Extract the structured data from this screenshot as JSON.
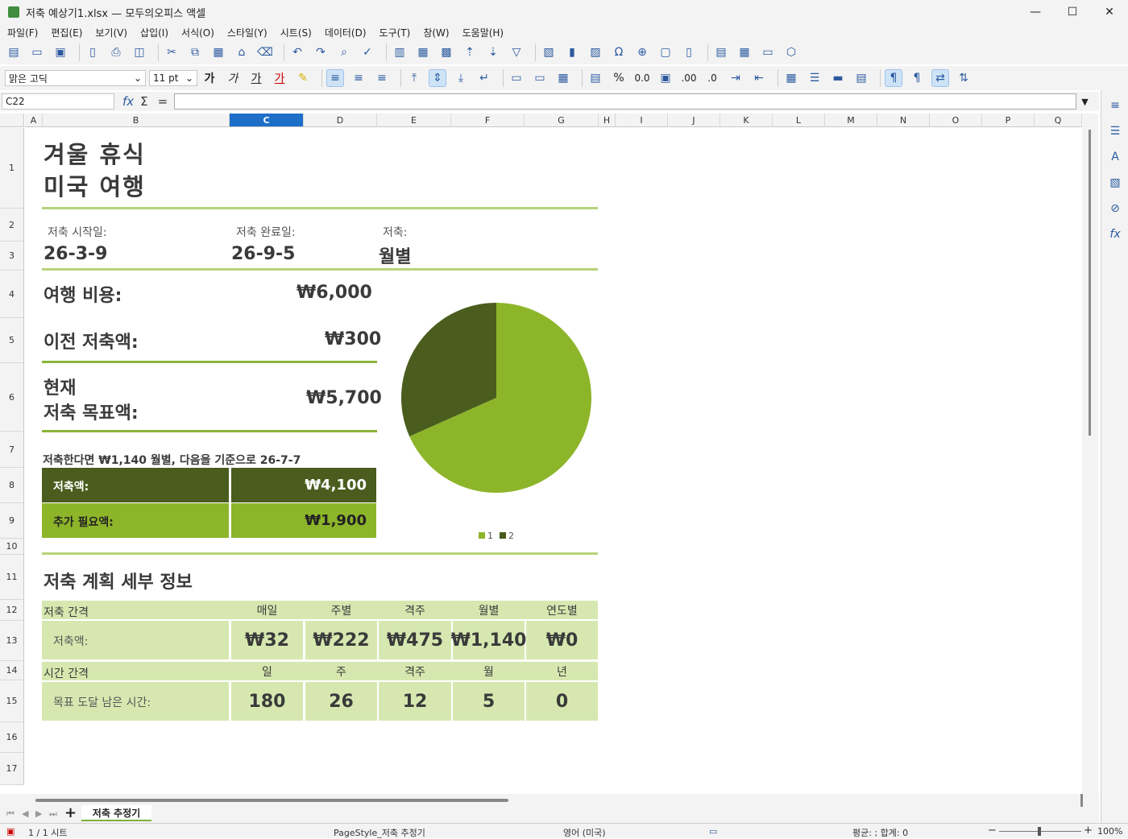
{
  "window": {
    "title": "저축 예상기1.xlsx — 모두의오피스 액셀",
    "minimize": "—",
    "maximize": "☐",
    "close": "✕"
  },
  "menu": [
    "파일(F)",
    "편집(E)",
    "보기(V)",
    "삽입(I)",
    "서식(O)",
    "스타일(Y)",
    "시트(S)",
    "데이터(D)",
    "도구(T)",
    "창(W)",
    "도움말(H)"
  ],
  "format_bar": {
    "font_name": "맑은 고딕",
    "font_size": "11 pt",
    "bold": "가",
    "italic": "가",
    "underline": "가",
    "font_color": "가",
    "percent": "%",
    "number": "0.0",
    "decimal_add": ".00",
    "decimal_remove": ".0"
  },
  "formula_bar": {
    "cell_ref": "C22",
    "fx": "fx",
    "sum": "Σ",
    "equals": "=",
    "value": ""
  },
  "columns": [
    "A",
    "B",
    "C",
    "D",
    "E",
    "F",
    "G",
    "H",
    "I",
    "J",
    "K",
    "L",
    "M",
    "N",
    "O",
    "P",
    "Q"
  ],
  "rows": [
    "1",
    "2",
    "3",
    "4",
    "5",
    "6",
    "7",
    "8",
    "9",
    "10",
    "11",
    "12",
    "13",
    "14",
    "15",
    "16",
    "17"
  ],
  "sheet": {
    "title_line1": "겨울 휴식",
    "title_line2": "미국 여행",
    "start_label": "저축 시작일:",
    "start_value": "26-3-9",
    "end_label": "저축 완료일:",
    "end_value": "26-9-5",
    "freq_label": "저축:",
    "freq_value": "월별",
    "trip_cost_label": "여행 비용:",
    "trip_cost_value": "₩6,000",
    "prev_savings_label": "이전 저축액:",
    "prev_savings_value": "₩300",
    "goal_label_1": "현재",
    "goal_label_2": "저축 목표액:",
    "goal_value": "₩5,700",
    "note": "저축한다면 ₩1,140 월별, 다음을 기준으로 26-7-7",
    "saved_label": "저축액:",
    "saved_value": "₩4,100",
    "needed_label": "추가 필요액:",
    "needed_value": "₩1,900",
    "details_title": "저축 계획 세부 정보",
    "interval_label": "저축 간격",
    "interval_headers": [
      "매일",
      "주별",
      "격주",
      "월별",
      "연도별"
    ],
    "amount_label": "저축액:",
    "amount_values": [
      "₩32",
      "₩222",
      "₩475",
      "₩1,140",
      "₩0"
    ],
    "time_label": "시간 간격",
    "time_headers": [
      "일",
      "주",
      "격주",
      "월",
      "년"
    ],
    "remaining_label": "목표 도달 남은 시간:",
    "remaining_values": [
      "180",
      "26",
      "12",
      "5",
      "0"
    ]
  },
  "chart_data": {
    "type": "pie",
    "categories": [
      "1",
      "2"
    ],
    "values": [
      4100,
      1900
    ],
    "colors": [
      "#8db52a",
      "#4a5d1e"
    ],
    "legend": "bottom"
  },
  "tabs": {
    "sheet_name": "저축 추정기",
    "add": "+"
  },
  "status": {
    "sheet_count": "1 / 1 시트",
    "page_style": "PageStyle_저축 추정기",
    "language": "영어 (미국)",
    "summary": "평균: ; 합계: 0",
    "zoom_minus": "−",
    "zoom_plus": "+",
    "zoom": "100%"
  },
  "colors": {
    "dark_green": "#4a5d1e",
    "mid_green": "#8db52a",
    "light_green": "#d6e8b0",
    "line_green": "#b6d37a",
    "text_dark": "#3a3a3a",
    "selected_col": "#1e6fc8"
  }
}
